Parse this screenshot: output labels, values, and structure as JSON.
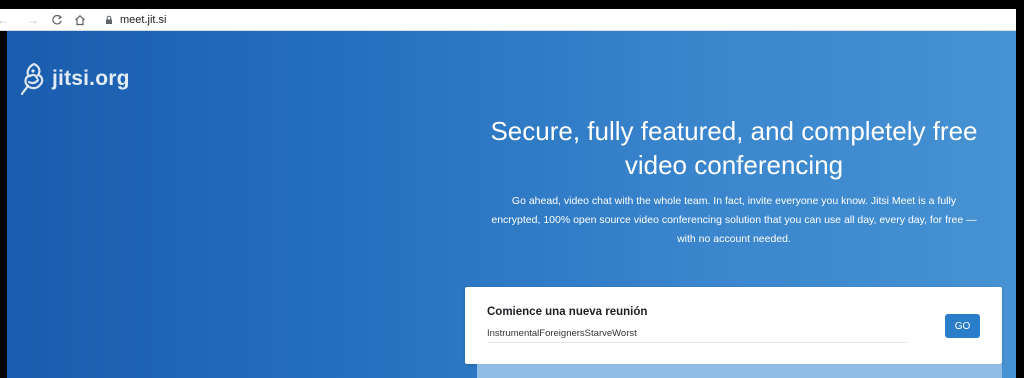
{
  "browser": {
    "url": "meet.jit.si",
    "icons": {
      "back": "back-arrow-icon",
      "forward": "forward-arrow-icon",
      "reload": "reload-icon",
      "home": "home-icon",
      "lock": "lock-icon"
    }
  },
  "header": {
    "logo_text": "jitsi.org"
  },
  "hero": {
    "title": "Secure, fully featured, and completely free video conferencing",
    "description": "Go ahead, video chat with the whole team. In fact, invite everyone you know. Jitsi Meet is a fully encrypted, 100% open source video conferencing solution that you can use all day, every day, for free — with no account needed."
  },
  "meeting_card": {
    "title": "Comience una nueva reunión",
    "room_name_value": "InstrumentalForeignersStarveWorst",
    "go_label": "GO"
  },
  "colors": {
    "gradient_start": "#1a5cad",
    "gradient_end": "#4692d2",
    "go_button": "#2a7dc8"
  }
}
